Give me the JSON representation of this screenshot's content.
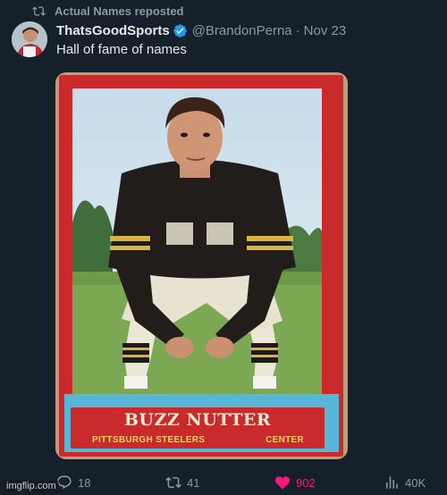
{
  "repost": {
    "label": "Actual Names reposted",
    "icon": "repost-icon"
  },
  "author": {
    "display_name": "ThatsGoodSports",
    "verified": true,
    "handle": "@BrandonPerna",
    "separator": "·",
    "date": "Nov 23"
  },
  "tweet": {
    "text": "Hall of fame of names"
  },
  "card": {
    "player_name": "BUZZ NUTTER",
    "team": "PITTSBURGH STEELERS",
    "position": "CENTER",
    "colors": {
      "border": "#c92a2b",
      "banner": "#57b5d8",
      "text_gold": "#f2d35f"
    }
  },
  "actions": {
    "replies": "18",
    "reposts": "41",
    "likes": "902",
    "views": "40K",
    "like_color": "#f91880"
  },
  "watermark": "imgflip.com"
}
